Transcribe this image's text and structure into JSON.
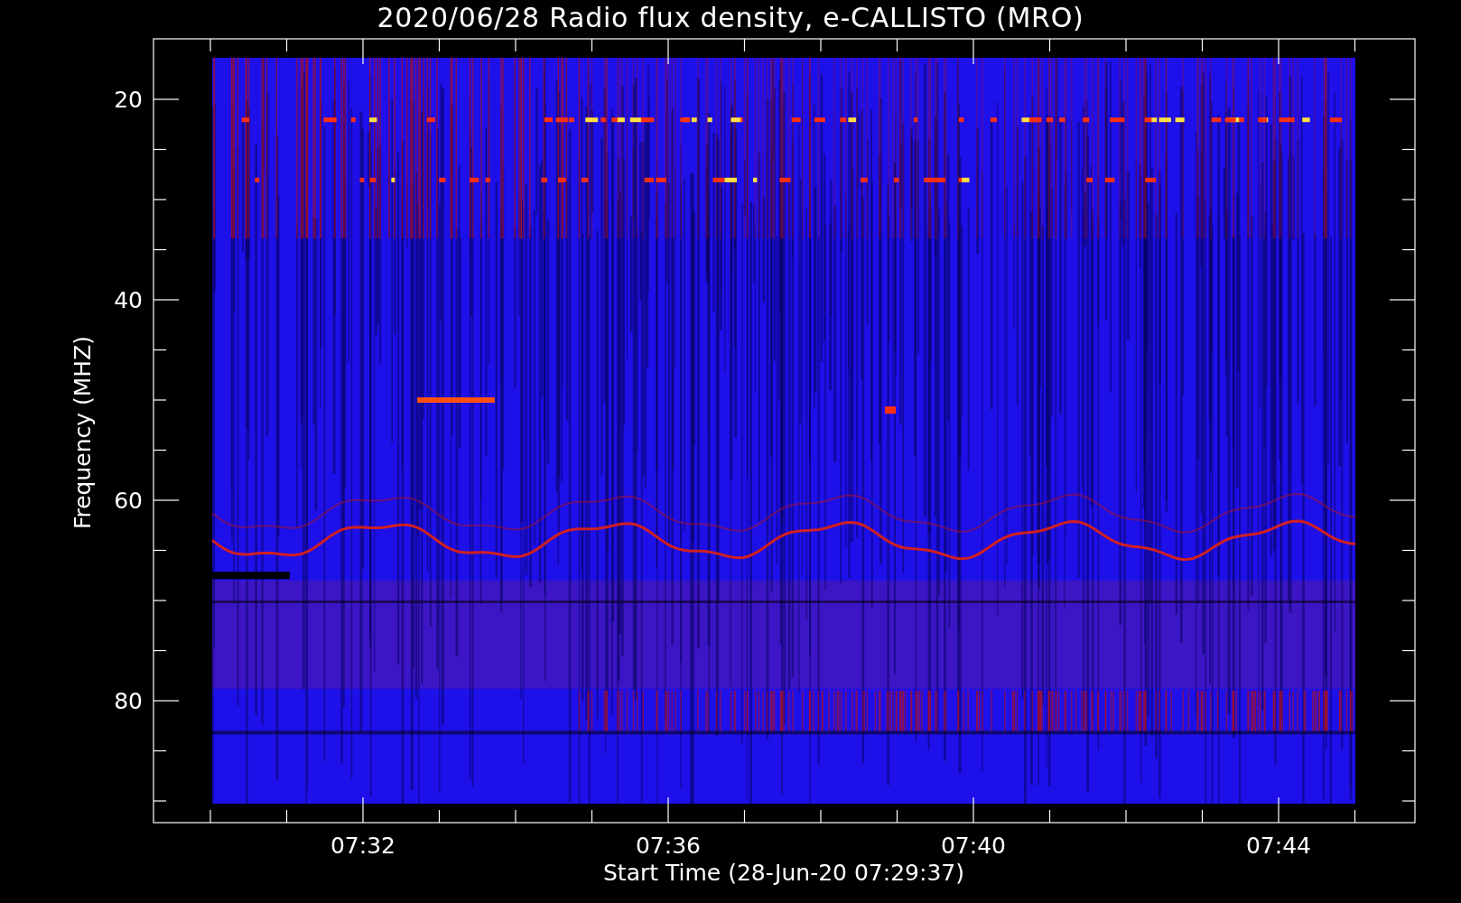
{
  "title": "2020/06/28  Radio flux density, e-CALLISTO (MRO)",
  "y_axis": {
    "label": "Frequency (MHZ)",
    "ticks": [
      "20",
      "40",
      "60",
      "80"
    ]
  },
  "x_axis": {
    "label": "Start Time (28-Jun-20 07:29:37)",
    "ticks": [
      "07:32",
      "07:36",
      "07:40",
      "07:44"
    ]
  }
}
